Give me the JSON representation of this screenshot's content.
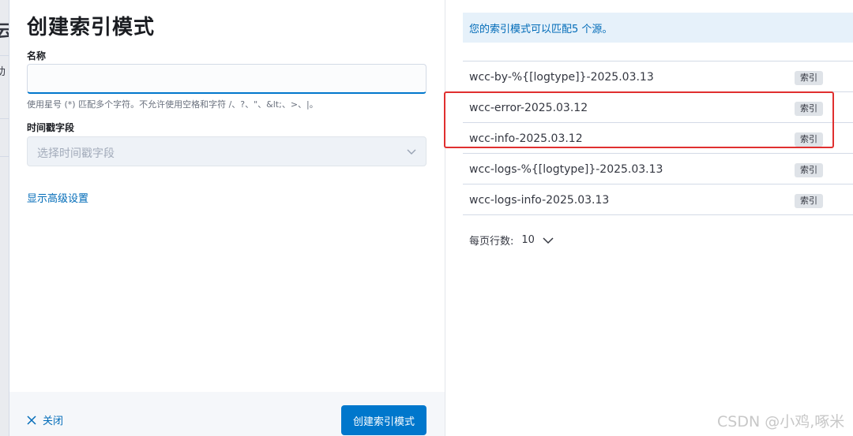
{
  "background": {
    "fragments": [
      "云",
      "助"
    ]
  },
  "flyout": {
    "title": "创建索引模式",
    "name_label": "名称",
    "name_value": "",
    "name_help": "使用星号 (*) 匹配多个字符。不允许使用空格和字符 /、?、\"、&lt;、>、|。",
    "timestamp_label": "时间戳字段",
    "timestamp_placeholder": "选择时间戳字段",
    "advanced_link": "显示高级设置",
    "close_label": "关闭",
    "create_label": "创建索引模式"
  },
  "sources": {
    "callout": "您的索引模式可以匹配5 个源。",
    "rows": [
      {
        "name": "wcc-by-%{[logtype]}-2025.03.13",
        "badge": "索引"
      },
      {
        "name": "wcc-error-2025.03.12",
        "badge": "索引"
      },
      {
        "name": "wcc-info-2025.03.12",
        "badge": "索引"
      },
      {
        "name": "wcc-logs-%{[logtype]}-2025.03.13",
        "badge": "索引"
      },
      {
        "name": "wcc-logs-info-2025.03.13",
        "badge": "索引"
      }
    ],
    "rows_per_page_label": "每页行数:",
    "rows_per_page_value": "10"
  },
  "watermark": "CSDN @小鸡,啄米",
  "colors": {
    "primary": "#0077cc",
    "link": "#006bb8",
    "highlight": "#e02f2f"
  }
}
